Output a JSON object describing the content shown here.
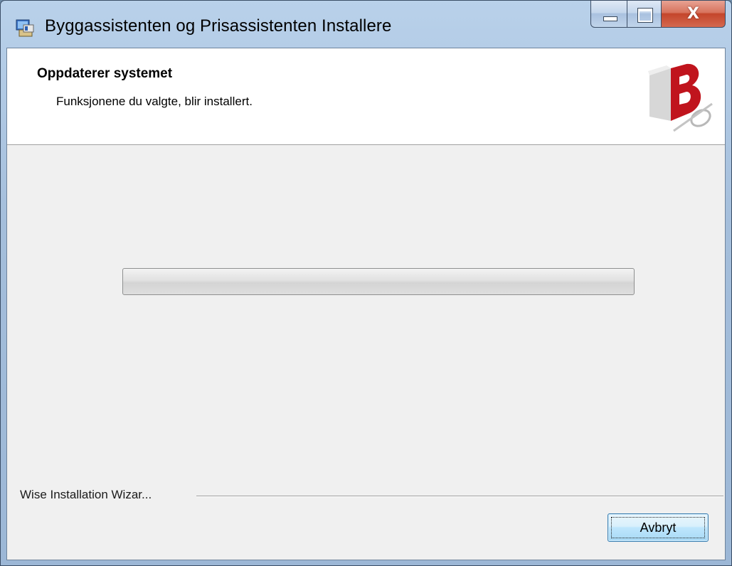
{
  "window": {
    "title": "Byggassistenten og Prisassistenten Installere",
    "app_icon": "installer-icon",
    "controls": {
      "minimize_icon": "minimize-icon",
      "maximize_icon": "maximize-icon",
      "close_label": "X"
    }
  },
  "header": {
    "title": "Oppdaterer systemet",
    "subtitle": "Funksjonene du valgte, blir installert.",
    "logo": "b-logo"
  },
  "progress": {
    "value": 0
  },
  "footer": {
    "brand": "Wise Installation Wizar...",
    "cancel_label": "Avbryt"
  },
  "colors": {
    "logo_red": "#c0141d",
    "button_border": "#3c7fb1",
    "progress_fill": "#37c24a"
  }
}
